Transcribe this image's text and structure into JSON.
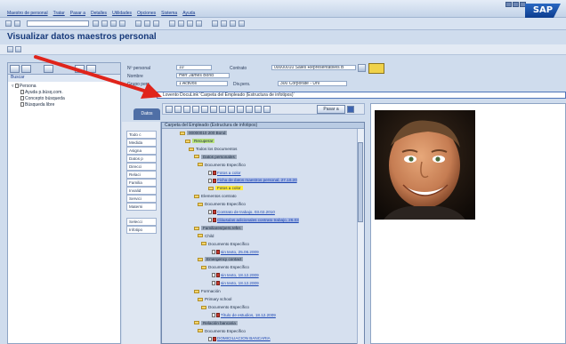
{
  "menu": [
    "Maestro de personal",
    "Tratar",
    "Pasar a",
    "Detalles",
    "Utilidades",
    "Opciones",
    "Sistema",
    "Ayuda"
  ],
  "sap_logo": "SAP",
  "title": "Visualizar datos maestros personal",
  "left": {
    "search_label": "Buscar",
    "tree": [
      "Persona",
      "Ayuda p.búsq.com.",
      "Concepto búsqueda",
      "Búsqueda libre"
    ]
  },
  "header": {
    "personal_label": "Nº personal",
    "personal_value": "10",
    "contrato_label": "Contrato",
    "contrato_value": "00000010 Sales Representatives B",
    "nombre_label": "Nombre",
    "nombre_value": "Herr James Bond",
    "grupo_label": "Grupo pers.",
    "grupo_value": "1  Activos",
    "div_label": "Div.pers.",
    "div_value": "300  Corporate - Uni"
  },
  "doc_field": "Lovento DocuLink 'Carpeta del Empleado (Estructura de infotipos)'",
  "tab_datos": "Datos",
  "pasar_button": "Pasar a",
  "tree_header": "Carpeta del Empleado (Estructura de infotipos)",
  "mid_rows": [
    "Todo c",
    "Medida",
    "Asigna",
    "Datos p",
    "Direcci",
    "Relaci",
    "Familia",
    "Invalid",
    "Servici",
    "Materni",
    "Selecci",
    "Infotipo"
  ],
  "tree_rows": [
    {
      "text": "00000010        200        Bond",
      "style": "hl-grey",
      "indent": 20
    },
    {
      "text": "Recuperar",
      "style": "hl-green",
      "indent": 26
    },
    {
      "text": "Todos los Documentos",
      "style": "",
      "indent": 30
    },
    {
      "text": "Datos personales",
      "style": "hl-grey",
      "indent": 36
    },
    {
      "text": "Documento Específico",
      "style": "",
      "indent": 40
    },
    {
      "text": "Fotos a color",
      "style": "lnk",
      "indent": 52
    },
    {
      "text": "Ficha de datos maestros personal, 27.10.20",
      "style": "lnk hl-blue",
      "indent": 52
    },
    {
      "text": "Fotos a color",
      "style": "hl-yellow",
      "indent": 52
    },
    {
      "text": "Elementos contrato",
      "style": "",
      "indent": 36
    },
    {
      "text": "Documento Específico",
      "style": "",
      "indent": 40
    },
    {
      "text": "Contrato de trabajo, 03.02.2010",
      "style": "lnk",
      "indent": 52
    },
    {
      "text": "Cláusulas adicionales contrato trabajo, 26.03",
      "style": "lnk hl-blue",
      "indent": 52
    },
    {
      "text": "Familiares/pers.refer.",
      "style": "hl-grey",
      "indent": 36
    },
    {
      "text": "Child",
      "style": "",
      "indent": 40
    },
    {
      "text": "Documento Específico",
      "style": "",
      "indent": 44
    },
    {
      "text": "sin texto, 25.06.2009",
      "style": "lnk",
      "indent": 56
    },
    {
      "text": "Emergency contact",
      "style": "hl-grey",
      "indent": 40
    },
    {
      "text": "Documento Específico",
      "style": "",
      "indent": 44
    },
    {
      "text": "sin texto, 18.12.2009",
      "style": "lnk",
      "indent": 56
    },
    {
      "text": "sin texto, 18.12.2009",
      "style": "lnk",
      "indent": 56
    },
    {
      "text": "Formación",
      "style": "",
      "indent": 36
    },
    {
      "text": "Primary school",
      "style": "",
      "indent": 40
    },
    {
      "text": "Documento Específico",
      "style": "",
      "indent": 44
    },
    {
      "text": "Título de estudios, 18.12.2009",
      "style": "lnk",
      "indent": 56
    },
    {
      "text": "Relación bancaria",
      "style": "hl-grey",
      "indent": 36
    },
    {
      "text": "Documento Específico",
      "style": "",
      "indent": 40
    },
    {
      "text": "DOMICILIACION BANCARIA",
      "style": "lnk",
      "indent": 52
    }
  ],
  "colors": {
    "arrow": "#e0241b",
    "title": "#16397a",
    "accent": "#4f6fa6"
  }
}
